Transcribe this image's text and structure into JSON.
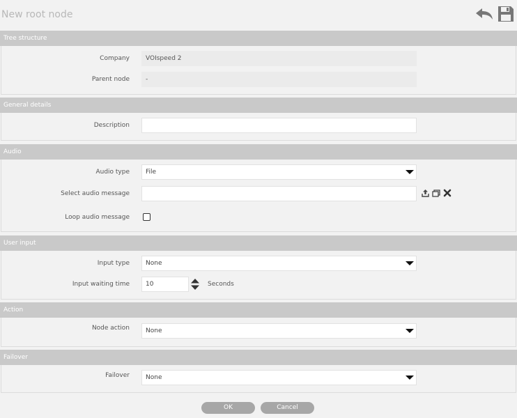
{
  "header": {
    "title": "New root node"
  },
  "sections": {
    "tree": {
      "title": "Tree structure",
      "company_label": "Company",
      "company_value": "VOIspeed 2",
      "parent_label": "Parent node",
      "parent_value": "-"
    },
    "general": {
      "title": "General details",
      "description_label": "Description",
      "description_value": ""
    },
    "audio": {
      "title": "Audio",
      "type_label": "Audio type",
      "type_value": "File",
      "message_label": "Select audio message",
      "message_value": "",
      "loop_label": "Loop audio message",
      "loop_checked": false
    },
    "user_input": {
      "title": "User input",
      "type_label": "Input type",
      "type_value": "None",
      "wait_label": "Input waiting time",
      "wait_value": "10",
      "wait_unit": "Seconds"
    },
    "action": {
      "title": "Action",
      "node_action_label": "Node action",
      "node_action_value": "None"
    },
    "failover": {
      "title": "Failover",
      "failover_label": "Failover",
      "failover_value": "None"
    }
  },
  "footer": {
    "ok_label": "OK",
    "cancel_label": "Cancel"
  },
  "icons": {
    "back": "undo-arrow-icon",
    "save": "floppy-disk-icon",
    "upload": "upload-icon",
    "copy": "copy-icon",
    "remove": "close-icon",
    "spin": "spinner-arrows-icon"
  },
  "colors": {
    "section_header": "#c9c9c9",
    "button": "#a7a7a7",
    "background": "#f2f2f2"
  }
}
